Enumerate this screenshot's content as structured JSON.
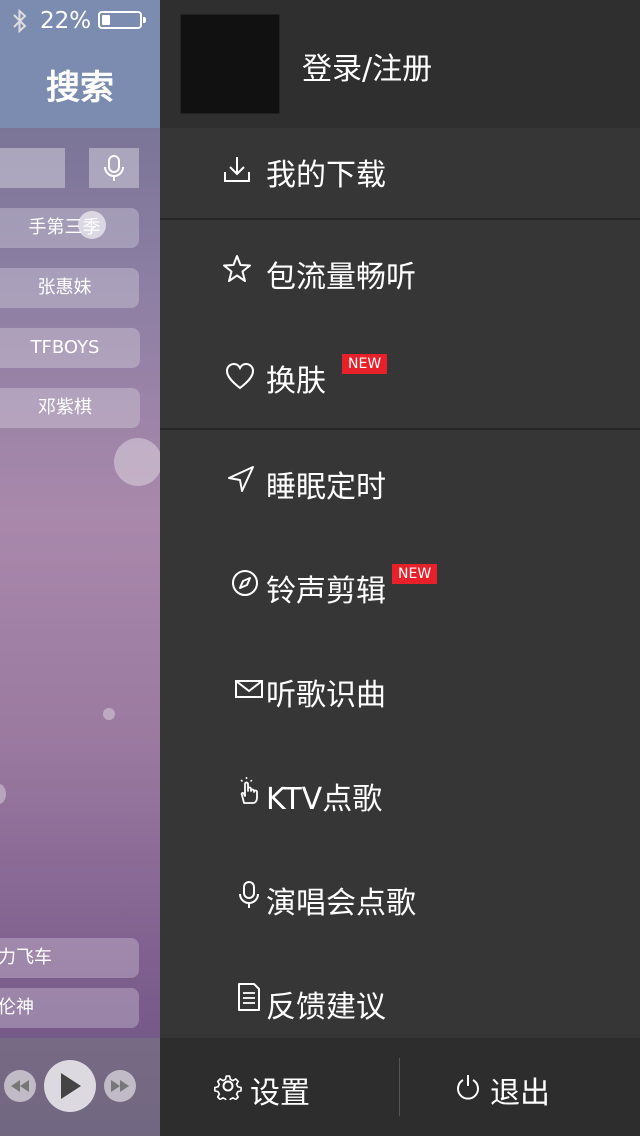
{
  "status": {
    "battery_pct": "22%",
    "battery_level": 0.22
  },
  "search_page": {
    "title": "搜索",
    "tags": [
      "手第三季",
      "张惠妹",
      "TFBOYS",
      "邓紫棋",
      "力飞车",
      "伦神"
    ]
  },
  "drawer": {
    "login_label": "登录/注册",
    "menu": [
      {
        "label": "我的下载",
        "icon": "download-icon",
        "new": false
      },
      {
        "label": "包流量畅听",
        "icon": "star-icon",
        "new": false
      },
      {
        "label": "换肤",
        "icon": "heart-icon",
        "new": true
      },
      {
        "label": "睡眠定时",
        "icon": "navigation-arrow-icon",
        "new": false
      },
      {
        "label": "铃声剪辑",
        "icon": "compass-icon",
        "new": true
      },
      {
        "label": "听歌识曲",
        "icon": "envelope-icon",
        "new": false
      },
      {
        "label": "KTV点歌",
        "icon": "tap-hand-icon",
        "new": false
      },
      {
        "label": "演唱会点歌",
        "icon": "microphone-icon",
        "new": false
      },
      {
        "label": "反馈建议",
        "icon": "document-icon",
        "new": false
      }
    ],
    "new_badge": "NEW",
    "settings_label": "设置",
    "logout_label": "退出"
  },
  "colors": {
    "drawer_bg": "#333333",
    "badge_red": "#e8202a"
  }
}
